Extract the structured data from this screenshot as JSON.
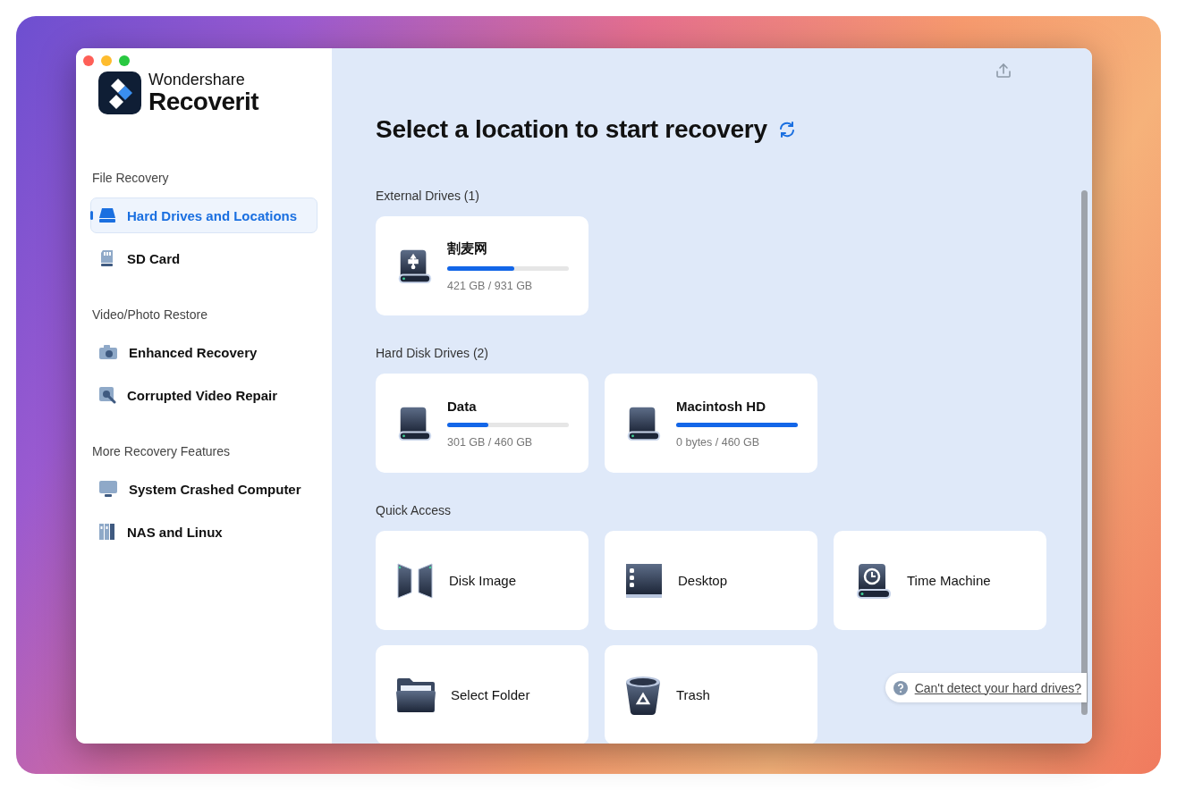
{
  "sidebar": {
    "brand": {
      "company": "Wondershare",
      "product": "Recoverit"
    },
    "sections": [
      {
        "title": "File Recovery",
        "items": [
          {
            "kind": "drive",
            "label": "Hard Drives and Locations",
            "selected": true
          },
          {
            "kind": "sd",
            "label": "SD Card",
            "selected": false
          }
        ]
      },
      {
        "title": "Video/Photo Restore",
        "items": [
          {
            "kind": "camera",
            "label": "Enhanced Recovery",
            "selected": false
          },
          {
            "kind": "repair",
            "label": "Corrupted Video Repair",
            "selected": false
          }
        ]
      },
      {
        "title": "More Recovery Features",
        "items": [
          {
            "kind": "monitor",
            "label": "System Crashed Computer",
            "selected": false
          },
          {
            "kind": "nas",
            "label": "NAS and Linux",
            "selected": false
          }
        ]
      }
    ]
  },
  "main": {
    "title": "Select a location to start recovery",
    "drive_groups": [
      {
        "title": "External Drives (1)",
        "drives": [
          {
            "kind": "usb",
            "name": "割麦网",
            "level": 0.55,
            "usage": "421 GB / 931 GB"
          }
        ]
      },
      {
        "title": "Hard Disk Drives (2)",
        "drives": [
          {
            "kind": "disk",
            "name": "Data",
            "level": 0.34,
            "usage": "301 GB / 460 GB"
          },
          {
            "kind": "disk",
            "name": "Macintosh HD",
            "level": 1,
            "usage": "0 bytes / 460 GB"
          }
        ]
      }
    ],
    "quick_access": {
      "title": "Quick Access",
      "items": [
        {
          "kind": "disk-image",
          "label": "Disk Image"
        },
        {
          "kind": "desktop",
          "label": "Desktop"
        },
        {
          "kind": "time-machine",
          "label": "Time Machine"
        },
        {
          "kind": "folder",
          "label": "Select Folder"
        },
        {
          "kind": "trash",
          "label": "Trash"
        }
      ]
    },
    "help_link": "Can't detect your hard drives?"
  }
}
